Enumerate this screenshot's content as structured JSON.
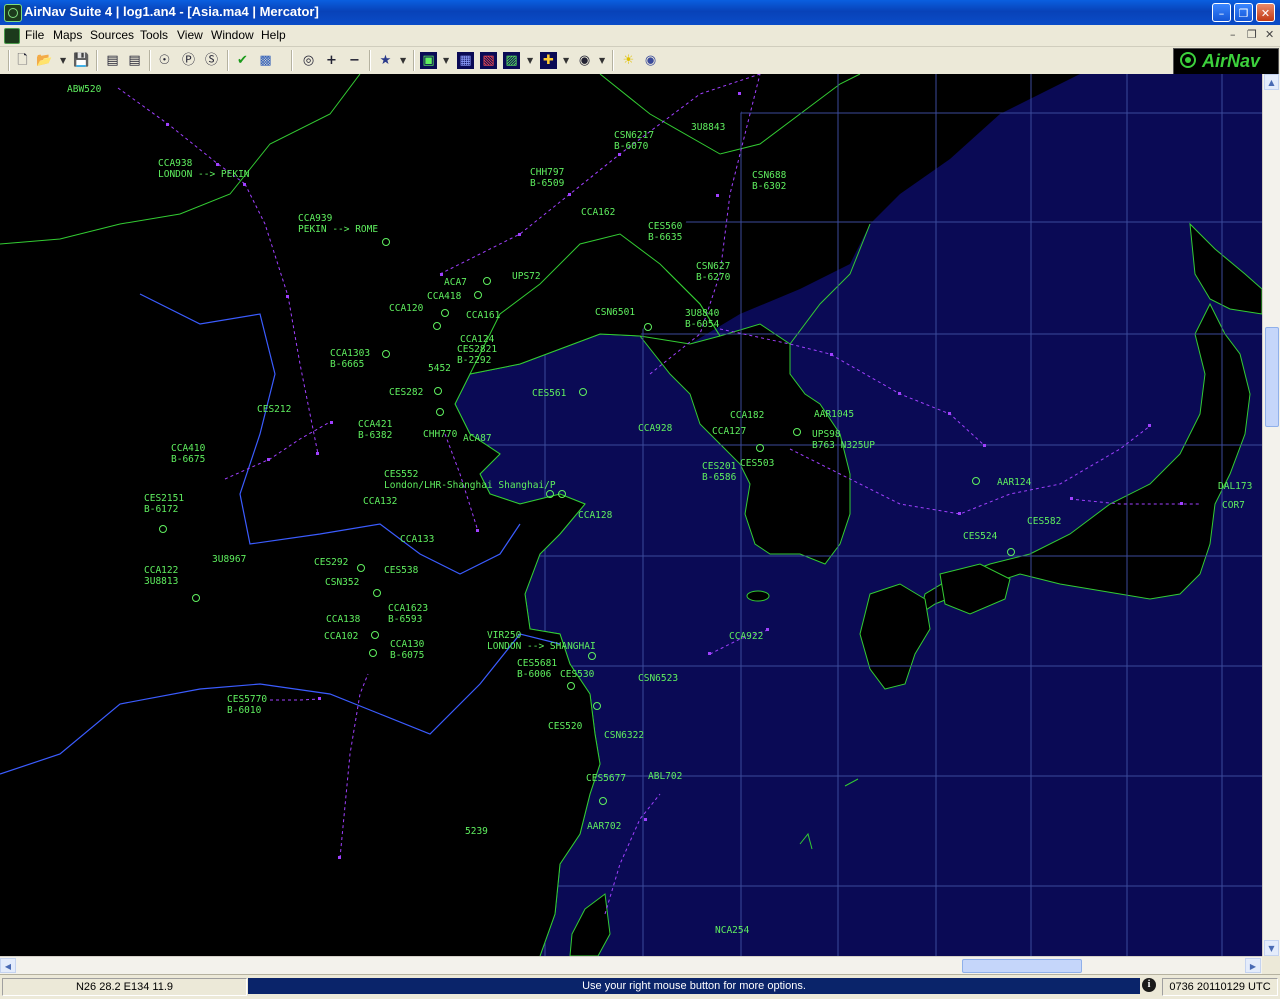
{
  "window": {
    "title": "AirNav Suite 4  |  log1.an4 - [Asia.ma4  |  Mercator]",
    "minimize_glyph": "–",
    "maximize_glyph": "❐",
    "close_glyph": "✕"
  },
  "menu": {
    "items": [
      "File",
      "Maps",
      "Sources",
      "Tools",
      "View",
      "Window",
      "Help"
    ],
    "mdi_controls": [
      "–",
      "❐",
      "✕"
    ]
  },
  "toolbar": {
    "icons": [
      "new-file-icon",
      "open-file-icon",
      "save-icon",
      "list-icon",
      "list-detail-icon",
      "globe-icon",
      "airport-icon",
      "sector-icon",
      "check-icon",
      "radar-icon",
      "zoom-fit-icon",
      "zoom-in-icon",
      "zoom-out-icon",
      "satellite-icon",
      "map-layer-icon",
      "grid-icon",
      "route-icon",
      "filter-icon",
      "range-icon",
      "target-icon",
      "weather-icon",
      "db-icon"
    ],
    "glyphs": {
      "zoom_in": "+",
      "zoom_out": "−"
    },
    "logo_text": "AirNav"
  },
  "map": {
    "projection": "Mercator",
    "colors": {
      "land": "#000000",
      "sea": "#0a0a55",
      "grid": "#3b4a9a",
      "label": "#5fef5f",
      "track": "#a040ff"
    },
    "labels": [
      {
        "text": "ABW520"
      },
      {
        "text": "CCA938\nLONDON --> PEKIN"
      },
      {
        "text": "CCA939\nPEKIN --> ROME"
      },
      {
        "text": "CSN6217\nB-6070"
      },
      {
        "text": "3U8843"
      },
      {
        "text": "CHH797\nB-6509"
      },
      {
        "text": "CSN688\nB-6302"
      },
      {
        "text": "CCA162"
      },
      {
        "text": "CES560\nB-6635"
      },
      {
        "text": "ACA7"
      },
      {
        "text": "UPS72"
      },
      {
        "text": "CSN627\nB-6270"
      },
      {
        "text": "CCA418"
      },
      {
        "text": "CCA120"
      },
      {
        "text": "CCA161"
      },
      {
        "text": "CSN6501"
      },
      {
        "text": "3U8840\nB-6054"
      },
      {
        "text": "CCA124"
      },
      {
        "text": "CES2821\nB-2292"
      },
      {
        "text": "CCA1303\nB-6665"
      },
      {
        "text": "5452"
      },
      {
        "text": "CES561"
      },
      {
        "text": "CES282"
      },
      {
        "text": "CES212"
      },
      {
        "text": "CCA421\nB-6382"
      },
      {
        "text": "CHH770"
      },
      {
        "text": "ACA87"
      },
      {
        "text": "CCA928"
      },
      {
        "text": "CCA182"
      },
      {
        "text": "AAR1045"
      },
      {
        "text": "CCA127"
      },
      {
        "text": "UPS98\nB763 N325UP"
      },
      {
        "text": "CCA410\nB-6675"
      },
      {
        "text": "CES201\nB-6586"
      },
      {
        "text": "CES503"
      },
      {
        "text": "CES552\nLondon/LHR-Shanghai Shanghai/P"
      },
      {
        "text": "AAR124"
      },
      {
        "text": "DAL173"
      },
      {
        "text": "CES2151\nB-6172"
      },
      {
        "text": "CCA132"
      },
      {
        "text": "CCA128"
      },
      {
        "text": "COR7"
      },
      {
        "text": "CES582"
      },
      {
        "text": "CCA133"
      },
      {
        "text": "CES524"
      },
      {
        "text": "3U8967"
      },
      {
        "text": "CES292"
      },
      {
        "text": "CES538"
      },
      {
        "text": "CCA122\n3U8813"
      },
      {
        "text": "CSN352"
      },
      {
        "text": "CCA1623\nB-6593"
      },
      {
        "text": "CCA138"
      },
      {
        "text": "CCA922"
      },
      {
        "text": "CCA102"
      },
      {
        "text": "CCA130\nB-6075"
      },
      {
        "text": "VIR250\nLONDON --> SHANGHAI"
      },
      {
        "text": "CES5681\nB-6006"
      },
      {
        "text": "CES530"
      },
      {
        "text": "CSN6523"
      },
      {
        "text": "CES5770\nB-6010"
      },
      {
        "text": "CES520"
      },
      {
        "text": "CSN6322"
      },
      {
        "text": "CES5677"
      },
      {
        "text": "ABL702"
      },
      {
        "text": "AAR702"
      },
      {
        "text": "5239"
      },
      {
        "text": "NCA254"
      }
    ]
  },
  "scroll": {
    "up": "▲",
    "down": "▼",
    "left": "◀",
    "right": "▶"
  },
  "status": {
    "coords": "N26 28.2 E134 11.9",
    "message": "Use your right mouse button for more options.",
    "info": "i",
    "time": "0736 20110129 UTC"
  }
}
